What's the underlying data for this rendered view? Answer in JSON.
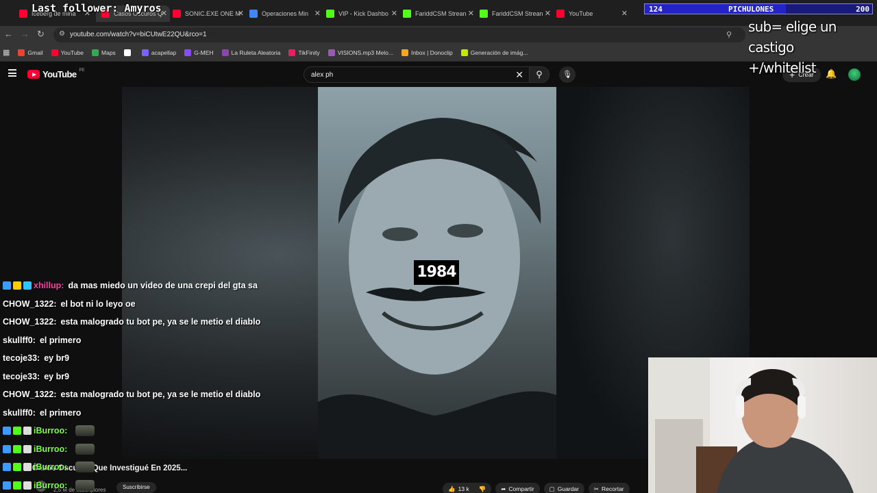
{
  "browser": {
    "tabs": [
      {
        "label": "Iceberg de mina",
        "active": false,
        "color": "#ff0033"
      },
      {
        "label": "Casos Oscuros Q",
        "active": true,
        "color": "#ff0033"
      },
      {
        "label": "SONIC.EXE ONE M",
        "active": false,
        "color": "#ff0033"
      },
      {
        "label": "Operaciones Min",
        "active": false,
        "color": "#4285f4"
      },
      {
        "label": "VIP - Kick Dashbo",
        "active": false,
        "color": "#53fc18"
      },
      {
        "label": "FariddCSM Strean",
        "active": false,
        "color": "#53fc18"
      },
      {
        "label": "FariddCSM Strean",
        "active": false,
        "color": "#53fc18"
      },
      {
        "label": "YouTube",
        "active": false,
        "color": "#ff0033"
      }
    ],
    "url": "youtube.com/watch?v=biCUtwE22QU&rco=1",
    "bookmarks": [
      {
        "label": "Gmail",
        "color": "#ea4335"
      },
      {
        "label": "YouTube",
        "color": "#ff0033"
      },
      {
        "label": "Maps",
        "color": "#34a853"
      },
      {
        "label": "",
        "color": "#ffffff"
      },
      {
        "label": "acapellap",
        "color": "#7b61ff"
      },
      {
        "label": "G-MEH",
        "color": "#8a4bff"
      },
      {
        "label": "La Ruleta Aleatoria",
        "color": "#8e44ad"
      },
      {
        "label": "TikFinity",
        "color": "#e91e63"
      },
      {
        "label": "VISIONS.mp3 Melo...",
        "color": "#9b59b6"
      },
      {
        "label": "Inbox | Donoclip",
        "color": "#f5a623"
      },
      {
        "label": "Generación de imág...",
        "color": "#c6e600"
      }
    ]
  },
  "youtube": {
    "logo_text": "YouTube",
    "country": "PE",
    "search_value": "alex ph",
    "create_label": "Crear",
    "video_overlay_year": "1984",
    "video_title": "Casos Oscuros Que Investigué En 2025...",
    "channel_name": "...",
    "channel_subs": "2,5 M de suscriptores",
    "subscribe_label": "Suscribirse",
    "likes": "13 k",
    "share_label": "Compartir",
    "save_label": "Guardar",
    "clip_label": "Recortar"
  },
  "stream": {
    "last_follower": "Last follower: Amyros",
    "goal": {
      "current": 124,
      "name": "PICHULONES",
      "target": 200
    },
    "info_lines": [
      "sub= elige un castigo",
      "+/whitelist"
    ],
    "chat": [
      {
        "user": "xhillup:",
        "color": "#ff3ea5",
        "text": "da mas miedo un video de una crepi del gta sa",
        "badges": [
          "#3d9bff",
          "#ffcc00",
          "#33c3ff"
        ],
        "emotes": 0
      },
      {
        "user": "CHOW_1322:",
        "color": "#ffffff",
        "text": "el bot ni lo leyo oe",
        "badges": [],
        "emotes": 0
      },
      {
        "user": "CHOW_1322:",
        "color": "#ffffff",
        "text": "esta malogrado tu bot pe, ya se le metio el diablo",
        "badges": [],
        "emotes": 0
      },
      {
        "user": "skullff0:",
        "color": "#ffffff",
        "text": "el primero",
        "badges": [],
        "emotes": 0
      },
      {
        "user": "tecoje33:",
        "color": "#ffffff",
        "text": "ey br9",
        "badges": [],
        "emotes": 0
      },
      {
        "user": "tecoje33:",
        "color": "#ffffff",
        "text": "ey br9",
        "badges": [],
        "emotes": 0
      },
      {
        "user": "CHOW_1322:",
        "color": "#ffffff",
        "text": "esta malogrado tu bot pe, ya se le metio el diablo",
        "badges": [],
        "emotes": 0
      },
      {
        "user": "skullff0:",
        "color": "#ffffff",
        "text": "el primero",
        "badges": [],
        "emotes": 0
      },
      {
        "user": "iBurroo:",
        "color": "#7dff4a",
        "text": "",
        "badges": [
          "#3d9bff",
          "#53fc18",
          "#dddddd"
        ],
        "emotes": 1
      },
      {
        "user": "iBurroo:",
        "color": "#7dff4a",
        "text": "",
        "badges": [
          "#3d9bff",
          "#53fc18",
          "#dddddd"
        ],
        "emotes": 1
      },
      {
        "user": "iBurroo:",
        "color": "#7dff4a",
        "text": "",
        "badges": [
          "#3d9bff",
          "#53fc18",
          "#dddddd"
        ],
        "emotes": 1
      },
      {
        "user": "iBurroo:",
        "color": "#7dff4a",
        "text": "",
        "badges": [
          "#3d9bff",
          "#53fc18",
          "#dddddd"
        ],
        "emotes": 1
      }
    ]
  }
}
